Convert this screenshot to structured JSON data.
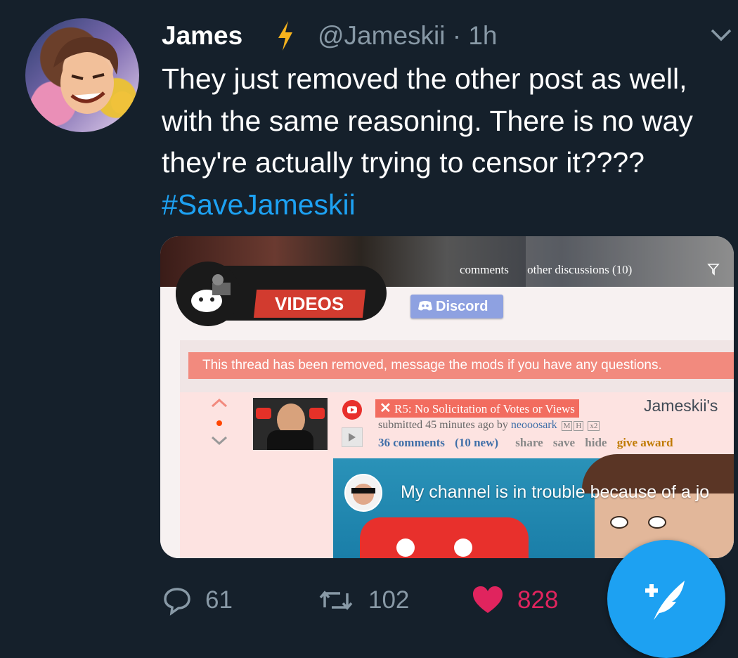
{
  "tweet": {
    "author_name": "James",
    "handle_time": "@Jameskii · 1h",
    "text_main": "They just removed the other post as well, with the same reasoning. There is no way they're actually trying to censor it???? ",
    "hashtag": "#SaveJameskii"
  },
  "media": {
    "tabs": [
      "comments",
      "other discussions (10)"
    ],
    "videos_tab": "VIDEOS",
    "discord_label": "Discord",
    "removed_notice": "This thread has been removed, message the mods if you have any questions.",
    "flair_x": "✕",
    "flair": "R5: No Solicitation of Votes or Views",
    "post_title": "Jameskii's",
    "submitted_prefix": "submitted 45 minutes ago by ",
    "submitted_user": "neooosark",
    "badge_m": "M",
    "badge_h": "H",
    "badge_x2": "x2",
    "comments_link": "36 comments",
    "new_count": "(10 new)",
    "share": "share",
    "save": "save",
    "hide": "hide",
    "give_award": "give award",
    "video_title": "My channel is in trouble because of a jo"
  },
  "actions": {
    "replies": "61",
    "retweets": "102",
    "likes": "828"
  },
  "colors": {
    "background": "#15202b",
    "accent": "#1da1f2",
    "like": "#e0245e",
    "muted": "#8899a6"
  },
  "icons": [
    "verified-bolt-icon",
    "chevron-down-icon",
    "reply-icon",
    "retweet-icon",
    "heart-icon",
    "compose-tweet-icon",
    "filter-icon",
    "discord-icon",
    "upvote-icon",
    "downvote-icon",
    "youtube-icon",
    "play-icon"
  ]
}
